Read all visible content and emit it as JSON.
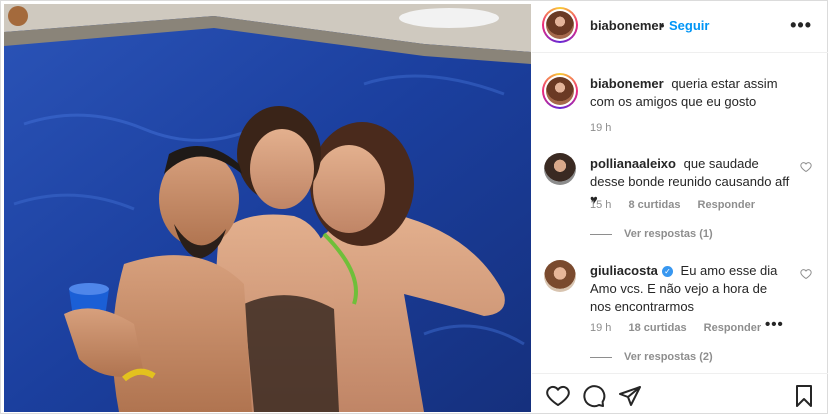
{
  "post": {
    "author": "biabonemer",
    "separator": "•",
    "follow_label": "Seguir",
    "more_icon": "more-horizontal-icon"
  },
  "caption": {
    "username": "biabonemer",
    "text": "queria estar assim com os amigos que eu gosto",
    "time": "19 h"
  },
  "comments": [
    {
      "username": "pollianaaleixo",
      "verified": false,
      "text": "que saudade desse bonde reunido causando aff ♥",
      "time": "15 h",
      "likes": "8 curtidas",
      "reply_label": "Responder",
      "view_replies": "Ver respostas (1)"
    },
    {
      "username": "giuliacosta",
      "verified": true,
      "text": "Eu amo esse dia Amo vcs. E não vejo a hora de nos encontrarmos",
      "time": "19 h",
      "likes": "18 curtidas",
      "reply_label": "Responder",
      "view_replies": "Ver respostas (2)"
    }
  ],
  "actions": [
    "like-heart-icon",
    "comment-icon",
    "share-icon",
    "save-bookmark-icon"
  ],
  "colors": {
    "link_blue": "#0095f6",
    "muted": "#8e8e8e",
    "text": "#262626",
    "pool": "#1e3f9c"
  }
}
